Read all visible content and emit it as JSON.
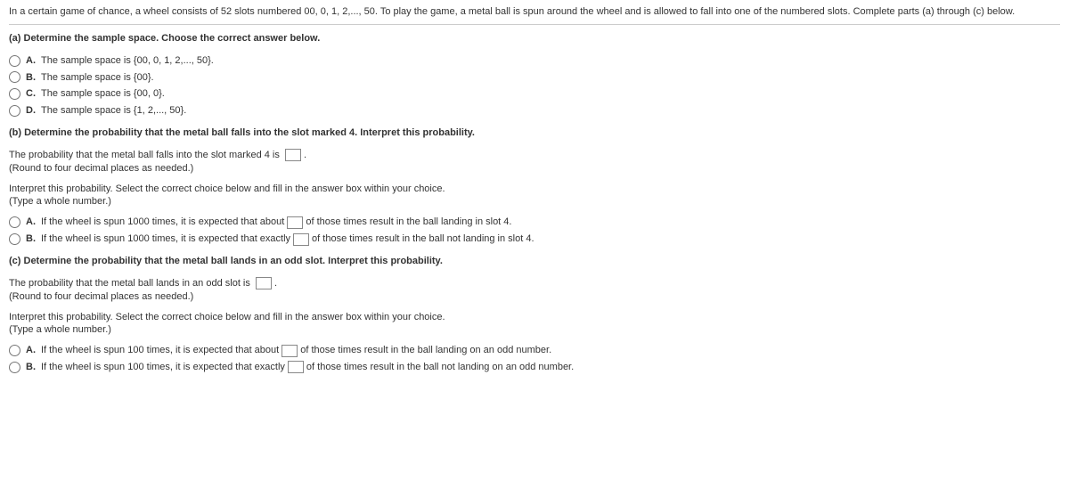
{
  "intro": "In a certain game of chance, a wheel consists of 52 slots numbered 00, 0, 1, 2,..., 50. To play the game, a metal ball is spun around the wheel and is allowed to fall into one of the numbered slots. Complete parts (a) through (c) below.",
  "partA": {
    "heading": "(a) Determine the sample space. Choose the correct answer below.",
    "options": [
      {
        "label": "A.",
        "text": "The sample space is {00, 0, 1, 2,..., 50}."
      },
      {
        "label": "B.",
        "text": "The sample space is {00}."
      },
      {
        "label": "C.",
        "text": "The sample space is {00, 0}."
      },
      {
        "label": "D.",
        "text": "The sample space is {1, 2,..., 50}."
      }
    ]
  },
  "partB": {
    "heading": "(b) Determine the probability that the metal ball falls into the slot marked 4. Interpret this probability.",
    "probText": "The probability that the metal ball falls into the slot marked 4 is ",
    "hint": "(Round to four decimal places as needed.)",
    "interpretPrompt": "Interpret this probability. Select the correct choice below and fill in the answer box within your choice.",
    "interpretHint": "(Type a whole number.)",
    "options": [
      {
        "label": "A.",
        "before": "If the wheel is spun 1000 times, it is expected that about ",
        "after": " of those times result in the ball landing in slot 4."
      },
      {
        "label": "B.",
        "before": "If the wheel is spun 1000 times, it is expected that exactly ",
        "after": " of those times result in the ball not landing in slot 4."
      }
    ]
  },
  "partC": {
    "heading": "(c) Determine the probability that the metal ball lands in an odd slot. Interpret this probability.",
    "probText": "The probability that the metal ball lands in an odd slot is ",
    "hint": "(Round to four decimal places as needed.)",
    "interpretPrompt": "Interpret this probability. Select the correct choice below and fill in the answer box within your choice.",
    "interpretHint": "(Type a whole number.)",
    "options": [
      {
        "label": "A.",
        "before": "If the wheel is spun 100 times, it is expected that about ",
        "after": " of those times result in the ball landing on an odd number."
      },
      {
        "label": "B.",
        "before": "If the wheel is spun 100 times, it is expected that exactly ",
        "after": " of those times result in the ball not landing on an odd number."
      }
    ]
  }
}
